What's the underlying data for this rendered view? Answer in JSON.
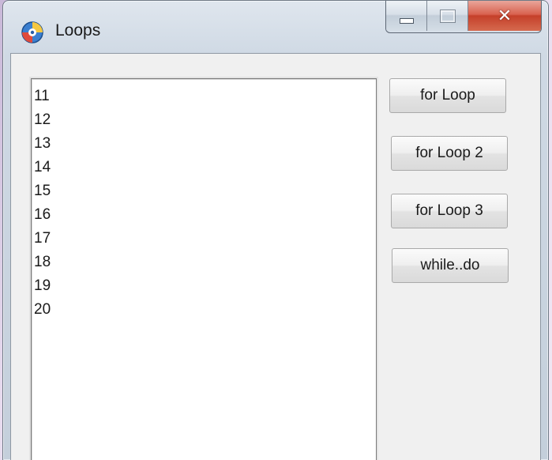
{
  "window": {
    "title": "Loops",
    "icon": "delphi-app-icon"
  },
  "caption_buttons": {
    "minimize": "minimize-icon",
    "maximize": "maximize-icon",
    "close": "close-icon"
  },
  "memo": {
    "lines": [
      "11",
      "12",
      "13",
      "14",
      "15",
      "16",
      "17",
      "18",
      "19",
      "20"
    ]
  },
  "buttons": {
    "for_loop": "for Loop",
    "for_loop_2": "for Loop 2",
    "for_loop_3": "for Loop 3",
    "while_do": "while..do"
  },
  "colors": {
    "close_button": "#c5402a",
    "client_background": "#f0f0f0",
    "memo_background": "#ffffff"
  }
}
